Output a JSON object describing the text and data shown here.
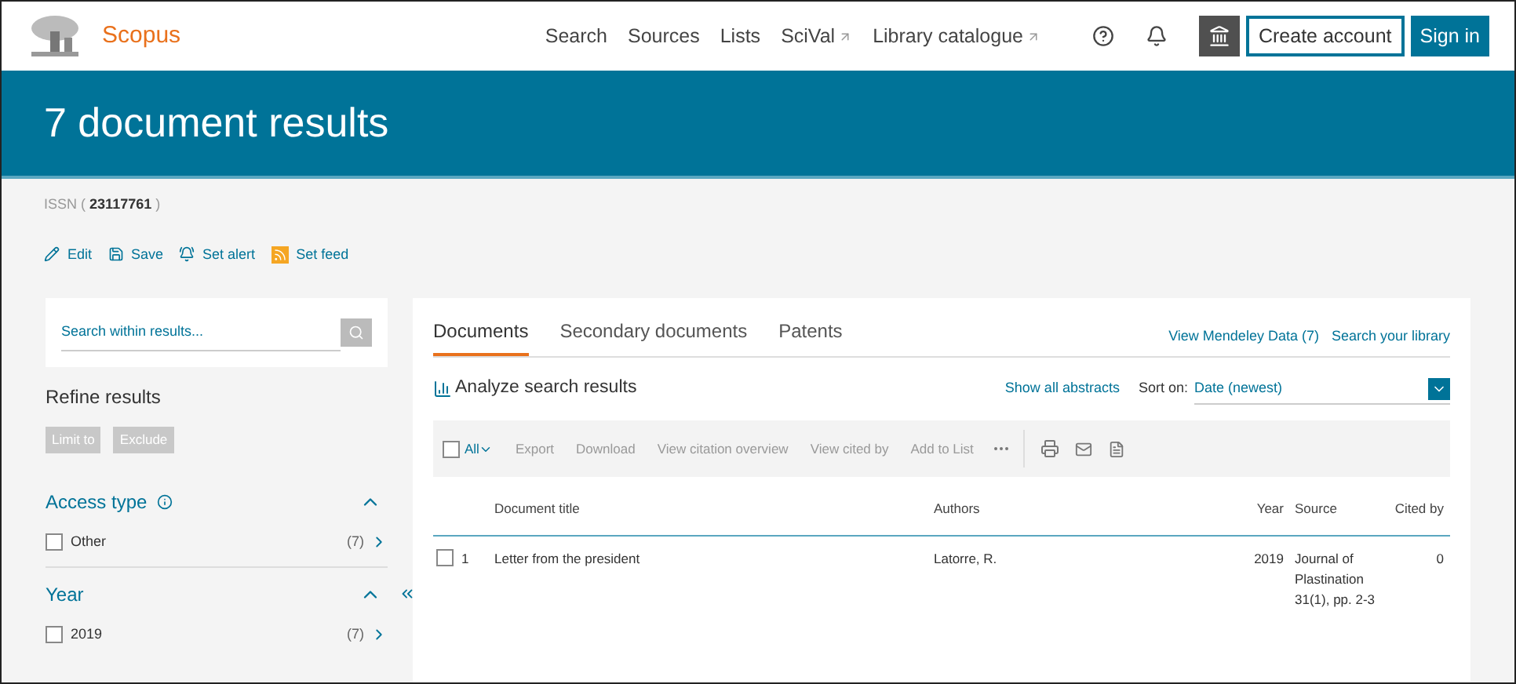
{
  "brand": "Scopus",
  "nav": [
    {
      "label": "Search",
      "external": false
    },
    {
      "label": "Sources",
      "external": false
    },
    {
      "label": "Lists",
      "external": false
    },
    {
      "label": "SciVal",
      "external": true
    },
    {
      "label": "Library catalogue",
      "external": true
    }
  ],
  "account_buttons": [
    {
      "label": "Create account",
      "kind": "outline"
    },
    {
      "label": "Sign in",
      "kind": "filled"
    }
  ],
  "title": "7 document results",
  "query": {
    "label": "ISSN",
    "open": "(",
    "value": "23117761",
    "close": ")"
  },
  "actions": [
    {
      "label": "Edit",
      "kind": "edit"
    },
    {
      "label": "Save",
      "kind": "save"
    },
    {
      "label": "Set alert",
      "kind": "alert"
    },
    {
      "label": "Set feed",
      "kind": "feed"
    }
  ],
  "sidebar": {
    "search_placeholder": "Search within results...",
    "heading": "Refine results",
    "buttons": [
      "Limit to",
      "Exclude"
    ],
    "facets": [
      {
        "title": "Access type",
        "info": true,
        "expanded": true,
        "items": [
          {
            "label": "Other",
            "count": "(7)",
            "checked": false
          }
        ]
      },
      {
        "title": "Year",
        "info": false,
        "expanded": true,
        "items": [
          {
            "label": "2019",
            "count": "(7)",
            "checked": false
          }
        ]
      }
    ]
  },
  "tabs": [
    {
      "label": "Documents",
      "selected": true
    },
    {
      "label": "Secondary documents",
      "selected": false
    },
    {
      "label": "Patents",
      "selected": false
    }
  ],
  "top_links": [
    "View Mendeley Data (7)",
    "Search your library"
  ],
  "analyze": "Analyze search results",
  "show_abstracts": "Show all abstracts",
  "sort": {
    "label": "Sort on:",
    "value": "Date (newest)"
  },
  "toolbar": {
    "select_all": {
      "label": "All",
      "checked": false
    },
    "actions": [
      "Export",
      "Download",
      "View citation overview",
      "View cited by",
      "Add to List"
    ]
  },
  "table": {
    "columns": [
      "Document title",
      "Authors",
      "Year",
      "Source",
      "Cited by"
    ],
    "rows": [
      {
        "checked": false,
        "index": "1",
        "title": "Letter from the president",
        "authors": "Latorre, R.",
        "year": "2019",
        "source": "Journal of Plastination 31(1), pp. 2-3",
        "cited_by": "0"
      }
    ]
  }
}
